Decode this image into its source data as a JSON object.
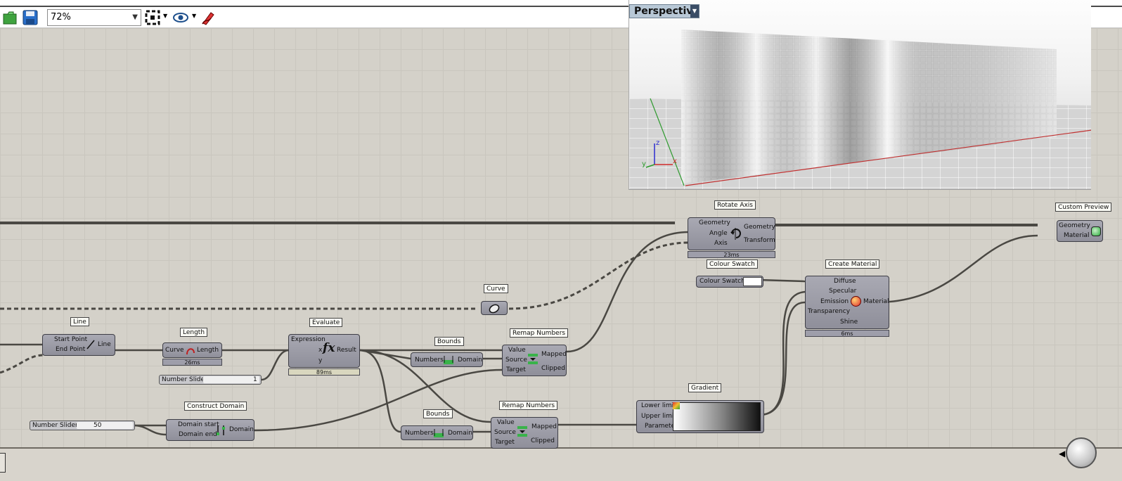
{
  "toolbar": {
    "zoom_value": "72%",
    "icons": [
      "open-file-icon",
      "save-icon",
      "zoom-extents-icon",
      "preview-eye-icon",
      "sketch-pen-icon"
    ]
  },
  "viewport": {
    "title": "Perspective",
    "axis_x": "x",
    "axis_y": "y",
    "axis_z": "z"
  },
  "components": {
    "line": {
      "tag": "Line",
      "in1": "Start Point",
      "in2": "End Point",
      "out": "Line"
    },
    "length": {
      "tag": "Length",
      "in": "Curve",
      "out": "Length",
      "time": "26ms"
    },
    "slider1": {
      "label": "Number Slider",
      "value": "1"
    },
    "evaluate": {
      "tag": "Evaluate",
      "in1": "Expression",
      "in2": "x",
      "in3": "y",
      "out": "Result",
      "time": "89ms"
    },
    "bounds1": {
      "tag": "Bounds",
      "in": "Numbers",
      "out": "Domain"
    },
    "curve": {
      "tag": "Curve"
    },
    "remap1": {
      "tag": "Remap Numbers",
      "in1": "Value",
      "in2": "Source",
      "in3": "Target",
      "out1": "Mapped",
      "out2": "Clipped"
    },
    "rotate": {
      "tag": "Rotate Axis",
      "in1": "Geometry",
      "in2": "Angle",
      "in3": "Axis",
      "out1": "Geometry",
      "out2": "Transform",
      "time": "23ms"
    },
    "swatch": {
      "tag": "Colour Swatch",
      "label": "Colour Swatch"
    },
    "material": {
      "tag": "Create Material",
      "in1": "Diffuse",
      "in2": "Specular",
      "in3": "Emission",
      "in4": "Transparency",
      "in5": "Shine",
      "out": "Material",
      "time": "6ms"
    },
    "preview": {
      "tag": "Custom Preview",
      "in1": "Geometry",
      "in2": "Material"
    },
    "slider2": {
      "label": "Number Slider",
      "value": "50"
    },
    "domain": {
      "tag": "Construct Domain",
      "in1": "Domain start",
      "in2": "Domain end",
      "out": "Domain"
    },
    "bounds2": {
      "tag": "Bounds",
      "in": "Numbers",
      "out": "Domain"
    },
    "remap2": {
      "tag": "Remap Numbers",
      "in1": "Value",
      "in2": "Source",
      "in3": "Target",
      "out1": "Mapped",
      "out2": "Clipped"
    },
    "gradient": {
      "tag": "Gradient",
      "in1": "Lower limit",
      "in2": "Upper limit",
      "in3": "Parameter"
    }
  }
}
